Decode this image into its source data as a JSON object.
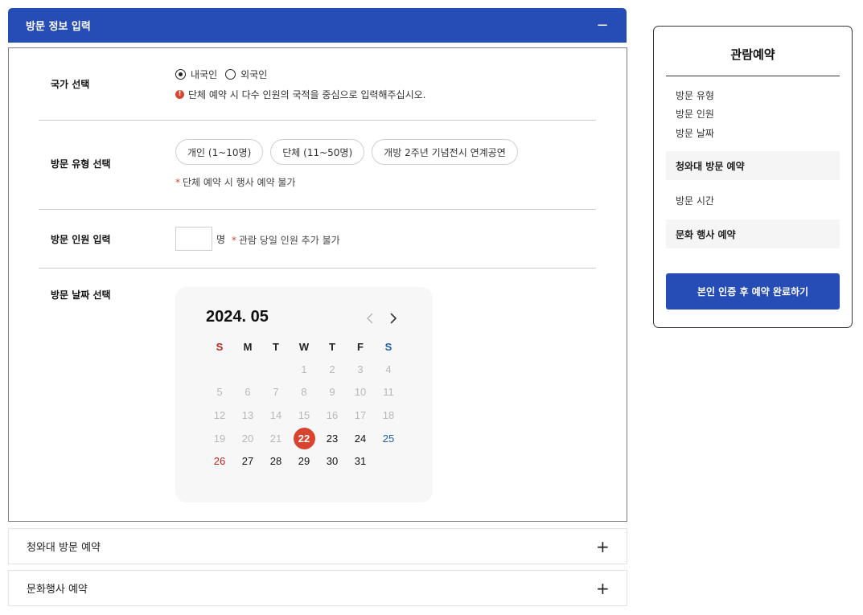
{
  "visit_info": {
    "header_title": "방문 정보 입력",
    "collapse_symbol": "−",
    "nationality": {
      "label": "국가 선택",
      "options": [
        "내국인",
        "외국인"
      ],
      "selected": "내국인",
      "notice": "단체 예약 시 다수 인원의 국적을 중심으로 입력해주십시오."
    },
    "visit_type": {
      "label": "방문 유형 선택",
      "options": [
        "개인 (1~10명)",
        "단체 (11~50명)",
        "개방 2주년 기념전시 연계공연"
      ],
      "note": "단체 예약 시 행사 예약 불가"
    },
    "visitor_count": {
      "label": "방문 인원 입력",
      "value": "",
      "unit": "명",
      "note": "관람 당일 인원 추가 불가"
    },
    "visit_date": {
      "label": "방문 날짜 선택"
    }
  },
  "calendar": {
    "month_label": "2024. 05",
    "weekdays": [
      "S",
      "M",
      "T",
      "W",
      "T",
      "F",
      "S"
    ],
    "first_weekday": 3,
    "days_in_month": 31,
    "today": 22,
    "selected_day": 22,
    "prev_icon": "chevron-left-icon",
    "next_icon": "chevron-right-icon",
    "colors": {
      "sunday": "#b3261e",
      "saturday": "#1f5fa0",
      "selected": "#d9442f",
      "disabled": "#b8b8b8"
    }
  },
  "sections": {
    "cheongwadae": {
      "label": "청와대 방문 예약",
      "expand_symbol": "+"
    },
    "culture_event": {
      "label": "문화행사 예약",
      "expand_symbol": "+"
    }
  },
  "summary": {
    "title": "관람예약",
    "items": [
      "방문 유형",
      "방문 인원",
      "방문 날짜"
    ],
    "band1": "청와대 방문 예약",
    "visit_time": "방문 시간",
    "band2": "문화 행사 예약",
    "button_label": "본인 인증 후 예약 완료하기"
  },
  "colors": {
    "primary": "#264db5",
    "accent": "#d9442f"
  }
}
